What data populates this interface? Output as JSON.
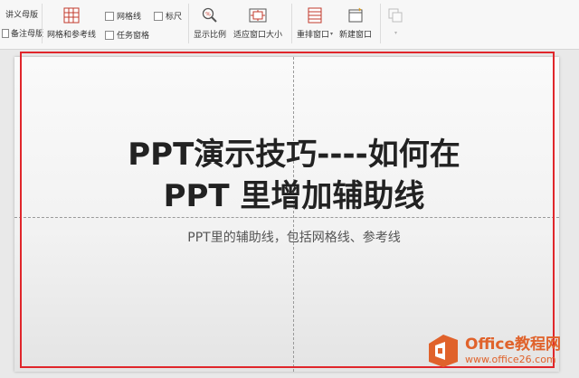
{
  "ribbon": {
    "handout_master": "讲义母版",
    "notes_master": "备注母版",
    "grid_and_guides": "网格和参考线",
    "gridlines": "网格线",
    "ruler": "标尺",
    "task_pane": "任务窗格",
    "zoom": "显示比例",
    "fit_to_window": "适应窗口大小",
    "arrange_windows": "重排窗口",
    "new_window": "新建窗口"
  },
  "slide": {
    "title_line1": "PPT演示技巧----如何在",
    "title_line2": "PPT 里增加辅助线",
    "subtitle": "PPT里的辅助线，包括网格线、参考线"
  },
  "watermark": {
    "main": "Office教程网",
    "url": "www.office26.com"
  },
  "colors": {
    "highlight": "#e0262b",
    "watermark": "#e0622b",
    "icon_accent": "#c0392b"
  }
}
